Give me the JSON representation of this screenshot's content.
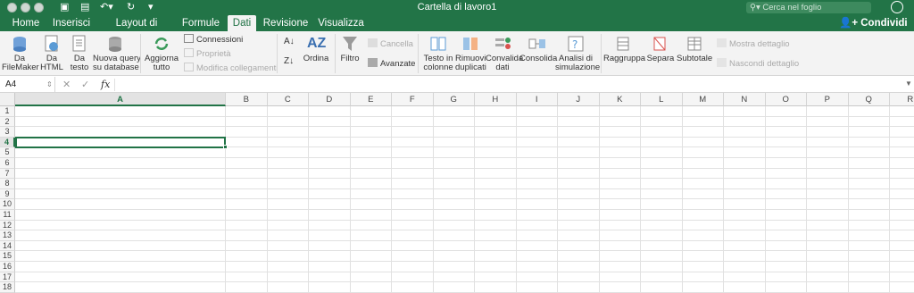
{
  "window": {
    "title": "Cartella di lavoro1",
    "search_placeholder": "Cerca nel foglio",
    "share_label": "Condividi"
  },
  "tabs": [
    {
      "label": "Home"
    },
    {
      "label": "Inserisci"
    },
    {
      "label": "Layout di pagina"
    },
    {
      "label": "Formule"
    },
    {
      "label": "Dati",
      "active": true
    },
    {
      "label": "Revisione"
    },
    {
      "label": "Visualizza"
    }
  ],
  "ribbon": {
    "da_filemaker": "Da\nFileMaker",
    "da_html": "Da\nHTML",
    "da_testo": "Da\ntesto",
    "nuova_query": "Nuova query\nsu database",
    "aggiorna_tutto": "Aggiorna\ntutto",
    "connessioni": "Connessioni",
    "proprieta": "Proprietà",
    "modifica_collegamenti": "Modifica collegamenti",
    "ordina": "Ordina",
    "filtro": "Filtro",
    "cancella": "Cancella",
    "avanzate": "Avanzate",
    "testo_in_colonne": "Testo in\ncolonne",
    "rimuovi_duplicati": "Rimuovi\nduplicati",
    "convalida_dati": "Convalida\ndati",
    "consolida": "Consolida",
    "analisi_simulazione": "Analisi di\nsimulazione",
    "raggruppa": "Raggruppa",
    "separa": "Separa",
    "subtotale": "Subtotale",
    "mostra_dettaglio": "Mostra dettaglio",
    "nascondi_dettaglio": "Nascondi dettaglio"
  },
  "formula_bar": {
    "name_box": "A4",
    "fx_label": "fx",
    "content": ""
  },
  "sheet": {
    "columns": [
      "A",
      "B",
      "C",
      "D",
      "E",
      "F",
      "G",
      "H",
      "I",
      "J",
      "K",
      "L",
      "M",
      "N",
      "O",
      "P",
      "Q",
      "R"
    ],
    "rows": [
      "1",
      "2",
      "3",
      "4",
      "5",
      "6",
      "7",
      "8",
      "9",
      "10",
      "11",
      "12",
      "13",
      "14",
      "15",
      "16",
      "17",
      "18"
    ],
    "active_cell": "A4",
    "accent_color": "#217346"
  },
  "colors": {
    "titlebar": "#227447",
    "ribbon": "#f3f3f3"
  }
}
